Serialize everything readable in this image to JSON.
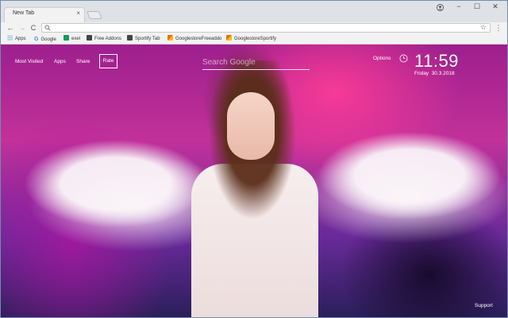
{
  "browser": {
    "tab_title": "New Tab",
    "tab_close": "×",
    "window_controls": {
      "minimize": "−",
      "maximize": "☐",
      "close": "✕"
    },
    "nav": {
      "back": "←",
      "forward": "→",
      "reload": "C"
    },
    "omnibox": {
      "value": "",
      "star": "☆"
    },
    "menu": "⋮",
    "bookmarks": [
      {
        "label": "Apps",
        "icon": "apps-grid-icon",
        "color": "#1a73e8"
      },
      {
        "label": "Google",
        "icon": "google-g-icon",
        "color": "#4285f4"
      },
      {
        "label": "exel",
        "icon": "sheets-icon",
        "color": "#0f9d58"
      },
      {
        "label": "Free Addons",
        "icon": "addon-icon",
        "color": "#333333"
      },
      {
        "label": "Sportify Tab",
        "icon": "tab-icon",
        "color": "#333333"
      },
      {
        "label": "GooglestoreFreeaddo",
        "icon": "store-icon",
        "color": "#e8710a"
      },
      {
        "label": "GooglestoreSportify",
        "icon": "store-icon",
        "color": "#e8710a"
      }
    ]
  },
  "newtab": {
    "nav": {
      "most_visited": "Most Visited",
      "apps": "Apps",
      "share": "Share",
      "rate": "Rate"
    },
    "search": {
      "placeholder": "Search Google"
    },
    "options": "Options",
    "clock": {
      "time": "11:59",
      "day": "Friday",
      "date": "30.3.2018"
    },
    "support": "Support",
    "colors": {
      "accent": "#ffffff",
      "background_primary": "#c2319a"
    }
  }
}
